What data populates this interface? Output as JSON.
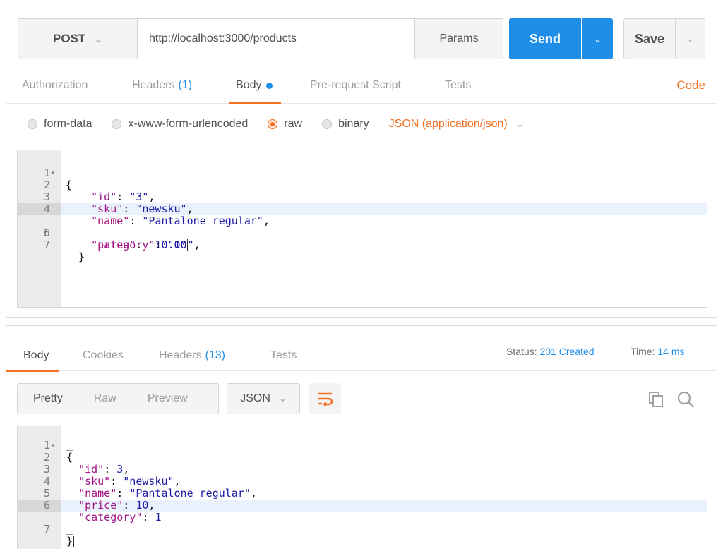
{
  "request": {
    "method": "POST",
    "url": "http://localhost:3000/products",
    "params_label": "Params",
    "send_label": "Send",
    "save_label": "Save",
    "tabs": [
      {
        "label": "Authorization",
        "count": ""
      },
      {
        "label": "Headers",
        "count": "(1)"
      },
      {
        "label": "Body",
        "count": ""
      },
      {
        "label": "Pre-request Script",
        "count": ""
      },
      {
        "label": "Tests",
        "count": ""
      }
    ],
    "active_tab": "Body",
    "code_label": "Code",
    "body_types": [
      "form-data",
      "x-www-form-urlencoded",
      "raw",
      "binary"
    ],
    "selected_body_type": "raw",
    "content_type": "JSON (application/json)",
    "editor_lines": [
      "1",
      "2",
      "3",
      "4",
      "5",
      "6",
      "7"
    ],
    "highlighted_line": "5"
  },
  "response": {
    "tabs": [
      {
        "label": "Body",
        "count": ""
      },
      {
        "label": "Cookies",
        "count": ""
      },
      {
        "label": "Headers",
        "count": "(13)"
      },
      {
        "label": "Tests",
        "count": ""
      }
    ],
    "active_tab": "Body",
    "status_label": "Status:",
    "status_value": "201 Created",
    "time_label": "Time:",
    "time_value": "14 ms",
    "view_modes": [
      "Pretty",
      "Raw",
      "Preview"
    ],
    "active_view": "Pretty",
    "format": "JSON",
    "editor_lines": [
      "1",
      "2",
      "3",
      "4",
      "5",
      "6",
      "7"
    ],
    "highlighted_line": "7"
  },
  "colors": {
    "accent": "#f47023",
    "primary": "#1f8ee9"
  }
}
